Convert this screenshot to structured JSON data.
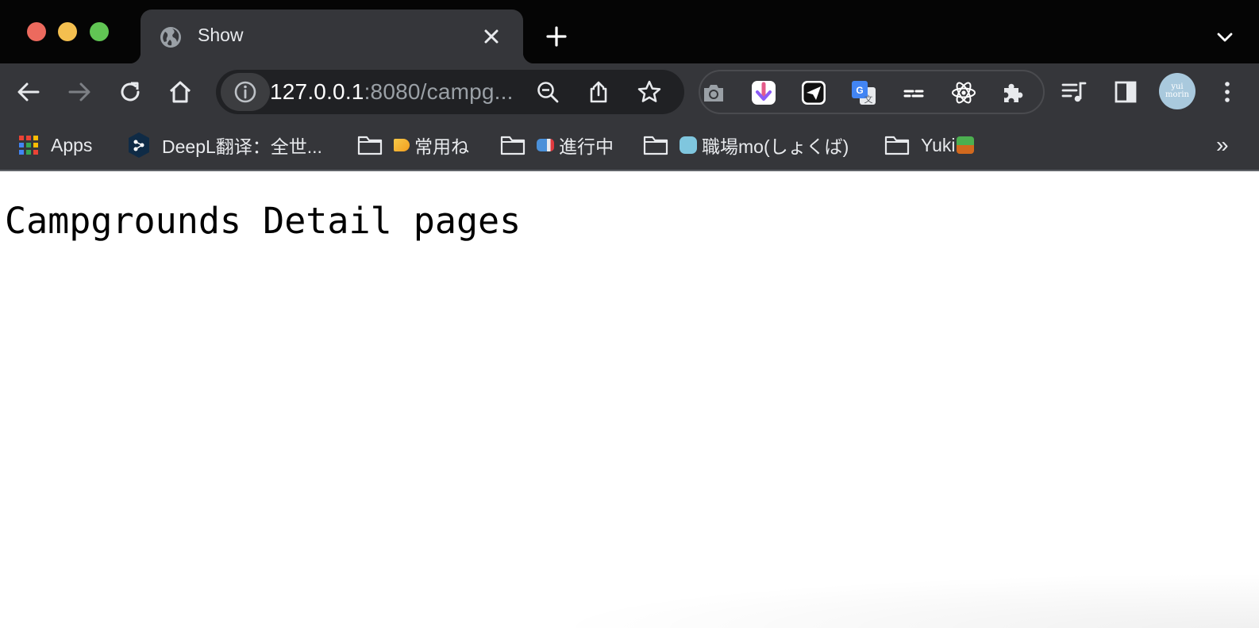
{
  "tab": {
    "title": "Show",
    "favicon": "globe-icon"
  },
  "toolbar": {
    "url_host": "127.0.0.1",
    "url_rest": ":8080/campg..."
  },
  "bookmarks": [
    {
      "label": "Apps",
      "icon": "apps-grid-icon"
    },
    {
      "label": "DeepL翻译：全世...",
      "icon": "deepl-icon"
    },
    {
      "label": "常用ね",
      "icon": "folder-icon",
      "emoji": "megaphone"
    },
    {
      "label": "進行中",
      "icon": "folder-icon",
      "emoji": "mailbox"
    },
    {
      "label": "職場mo(しょくば)",
      "icon": "folder-icon",
      "emoji": "robot"
    },
    {
      "label": "Yuki",
      "icon": "folder-icon",
      "emoji": "potted-plant"
    }
  ],
  "bookmarks_more": "»",
  "avatar_text": "yui\nmorin",
  "page": {
    "heading": "Campgrounds Detail pages"
  }
}
